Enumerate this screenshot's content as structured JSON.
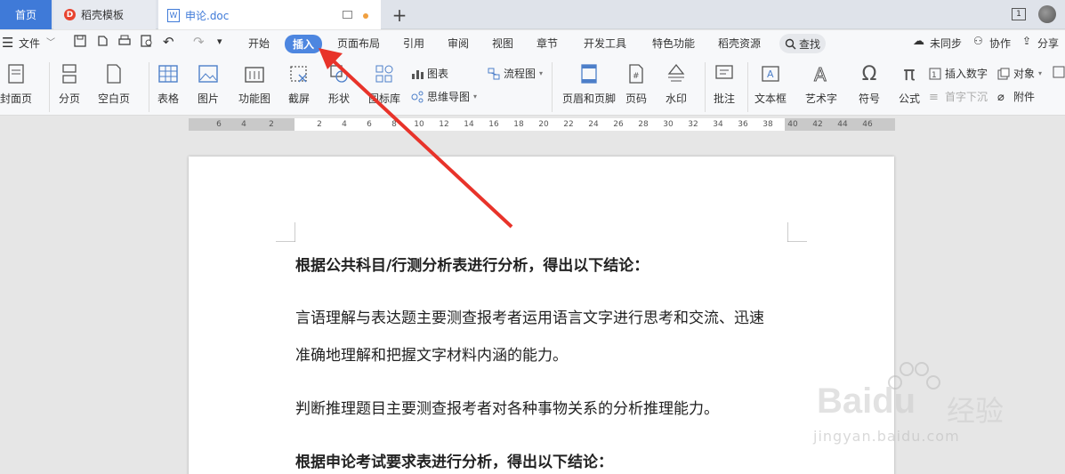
{
  "tabs": {
    "home": "首页",
    "docer": "稻壳模板",
    "doc": "申论.doc",
    "doc_icon": "W",
    "docer_icon": "D",
    "add": "+"
  },
  "titlebar": {
    "page_indicator": "1"
  },
  "menu": {
    "file": "文件",
    "items": [
      "开始",
      "插入",
      "页面布局",
      "引用",
      "审阅",
      "视图",
      "章节",
      "开发工具",
      "特色功能",
      "稻壳资源"
    ],
    "search": "查找",
    "unsync": "未同步",
    "collab": "协作",
    "share": "分享"
  },
  "ribbon": {
    "cover": "封面页",
    "pagebreak": "分页",
    "blankpage": "空白页",
    "table": "表格",
    "picture": "图片",
    "funcchart": "功能图",
    "screenshot": "截屏",
    "shape": "形状",
    "iconlib": "图标库",
    "chart": "图表",
    "mindmap": "思维导图",
    "flowchart": "流程图",
    "headerfooter": "页眉和页脚",
    "pagenum": "页码",
    "watermark": "水印",
    "comment": "批注",
    "textbox": "文本框",
    "wordart": "艺术字",
    "symbol": "符号",
    "formula": "公式",
    "insertnum": "插入数字",
    "object": "对象",
    "dropcap": "首字下沉",
    "attachment": "附件"
  },
  "ruler": {
    "left": [
      "6",
      "4",
      "2"
    ],
    "right": [
      "2",
      "4",
      "6",
      "8",
      "10",
      "12",
      "14",
      "16",
      "18",
      "20",
      "22",
      "24",
      "26",
      "28",
      "30",
      "32",
      "34",
      "36",
      "38",
      "40",
      "42",
      "44",
      "46"
    ]
  },
  "document": {
    "p1": "根据公共科目/行测分析表进行分析，得出以下结论：",
    "p2a": "言语理解与表达题主要测查报考者运用语言文字进行思考和交流、迅速",
    "p2b": "准确地理解和把握文字材料内涵的能力。",
    "p3": "判断推理题目主要测查报考者对各种事物关系的分析推理能力。",
    "p4": "根据申论考试要求表进行分析，得出以下结论："
  },
  "watermark": {
    "brand": "Baidu",
    "cn": "经验",
    "url": "jingyan.baidu.com"
  },
  "colors": {
    "accent": "#3f7ad8",
    "active_tab": "#4d86e0",
    "arrow": "#e8332a"
  }
}
